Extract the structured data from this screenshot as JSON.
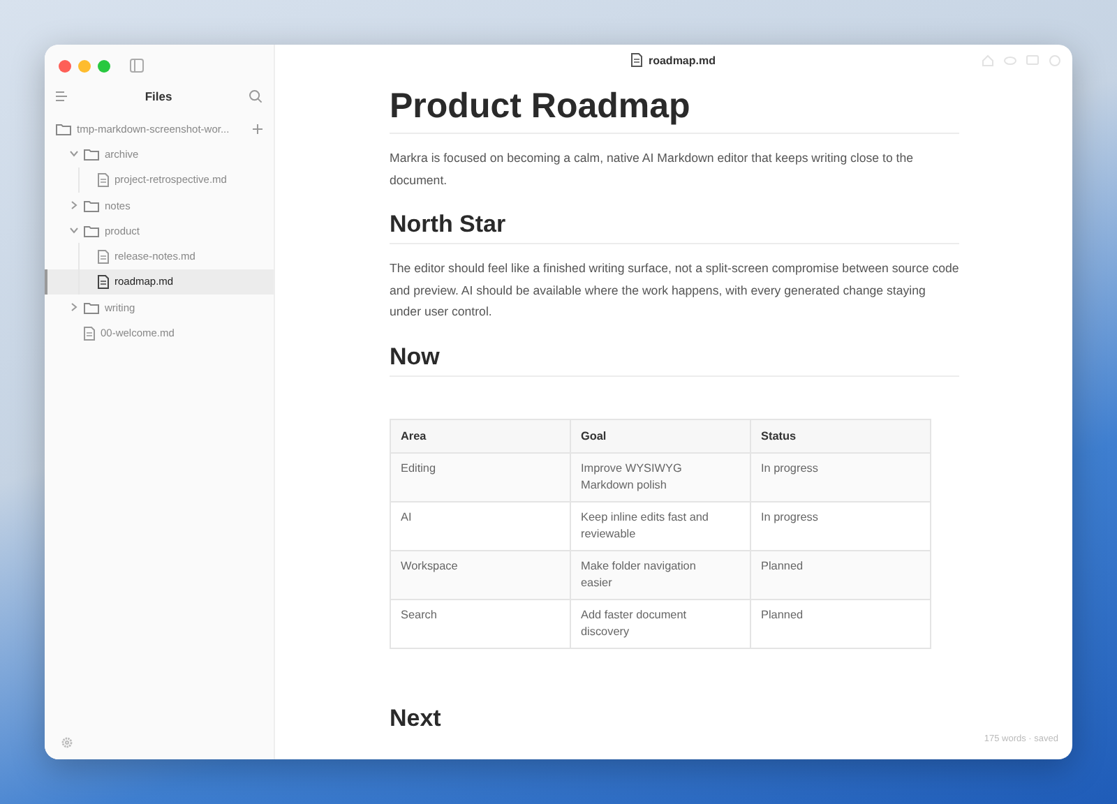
{
  "sidebar": {
    "title": "Files",
    "tree": [
      {
        "kind": "folder",
        "label": "tmp-markdown-screenshot-wor...",
        "selected": false,
        "children": [
          {
            "kind": "folder",
            "label": "archive",
            "expanded": true,
            "selected": false,
            "children": [
              {
                "kind": "file",
                "label": "project-retrospective.md",
                "selected": false
              }
            ]
          },
          {
            "kind": "folder",
            "label": "notes",
            "expanded": false,
            "selected": false
          },
          {
            "kind": "folder",
            "label": "product",
            "expanded": true,
            "selected": false,
            "children": [
              {
                "kind": "file",
                "label": "release-notes.md",
                "selected": false
              },
              {
                "kind": "file",
                "label": "roadmap.md",
                "selected": true
              }
            ]
          },
          {
            "kind": "folder",
            "label": "writing",
            "expanded": false,
            "selected": false
          },
          {
            "kind": "file",
            "label": "00-welcome.md",
            "selected": false
          }
        ]
      }
    ]
  },
  "document": {
    "filename": "roadmap.md",
    "blocks": [
      {
        "kind": "h1",
        "text": "Product Roadmap"
      },
      {
        "kind": "p",
        "text": "Markra is focused on becoming a calm, native AI Markdown editor that keeps writing close to the document."
      },
      {
        "kind": "h2",
        "text": "North Star"
      },
      {
        "kind": "p",
        "text": "The editor should feel like a finished writing surface, not a split-screen compromise between source code and preview. AI should be available where the work happens, with every generated change staying under user control."
      },
      {
        "kind": "h2",
        "text": "Now"
      },
      {
        "kind": "table",
        "columns": [
          "Area",
          "Goal",
          "Status"
        ],
        "rows": [
          [
            "Editing",
            "Improve WYSIWYG Markdown polish",
            "In progress"
          ],
          [
            "AI",
            "Keep inline edits fast and reviewable",
            "In progress"
          ],
          [
            "Workspace",
            "Make folder navigation easier",
            "Planned"
          ],
          [
            "Search",
            "Add faster document discovery",
            "Planned"
          ]
        ]
      },
      {
        "kind": "h2",
        "text": "Next"
      }
    ]
  },
  "status_bar": {
    "text": "175 words · saved"
  }
}
